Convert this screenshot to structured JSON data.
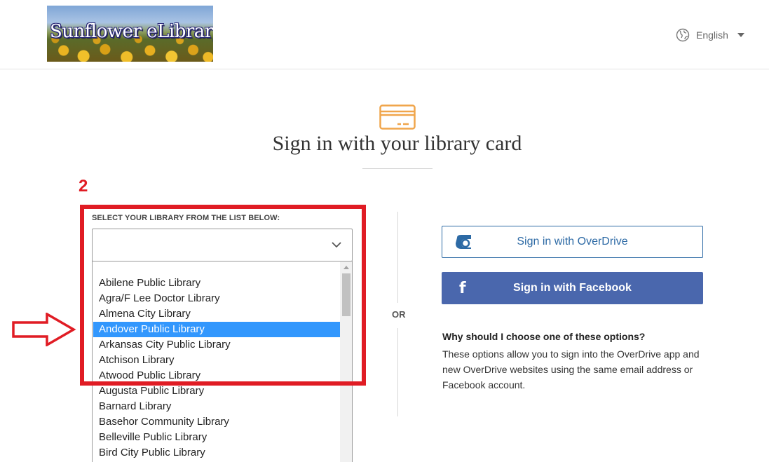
{
  "header": {
    "logo_text": "Sunflower eLibrary",
    "language": "English"
  },
  "main": {
    "title": "Sign in with your library card"
  },
  "annotation": {
    "step_number": "2",
    "color": "#e01c24"
  },
  "library_select": {
    "label": "SELECT YOUR LIBRARY FROM THE LIST BELOW:",
    "value": "",
    "selected_option": "Andover Public Library",
    "options": [
      "",
      "Abilene Public Library",
      "Agra/F Lee Doctor Library",
      "Almena City Library",
      "Andover Public Library",
      "Arkansas City Public Library",
      "Atchison Library",
      "Atwood Public Library",
      "Augusta Public Library",
      "Barnard Library",
      "Basehor Community Library",
      "Belleville Public Library",
      "Bird City Public Library"
    ]
  },
  "divider": {
    "or_label": "OR"
  },
  "sign_in": {
    "overdrive_label": "Sign in with OverDrive",
    "facebook_label": "Sign in with Facebook",
    "overdrive_color": "#2d6aa5",
    "facebook_color": "#4a67ad",
    "why_title": "Why should I choose one of these options?",
    "why_body": "These options allow you to sign into the OverDrive app and new OverDrive websites using the same email address or Facebook account."
  },
  "icons": {
    "globe": "globe-icon",
    "card": "library-card-icon",
    "chevron": "chevron-down-icon",
    "overdrive": "overdrive-logo-icon",
    "facebook": "facebook-icon",
    "arrow": "arrow-right-icon"
  }
}
